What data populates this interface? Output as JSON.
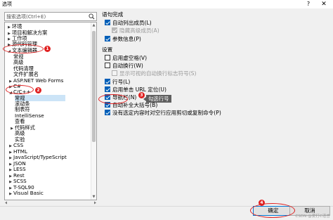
{
  "window": {
    "title": "选项",
    "help_label": "?",
    "close_label": "✕"
  },
  "search": {
    "placeholder": "搜索选项(Ctrl+E)"
  },
  "tree": {
    "items": [
      {
        "label": "环境",
        "arrow": "▶"
      },
      {
        "label": "项目和解决方案",
        "arrow": "▶"
      },
      {
        "label": "工作项",
        "arrow": "▶"
      },
      {
        "label": "源代码管理",
        "arrow": "▶"
      },
      {
        "label": "文本编辑器",
        "arrow": "◢"
      },
      {
        "label": "常规",
        "arrow": ""
      },
      {
        "label": "高级",
        "arrow": ""
      },
      {
        "label": "代码清理",
        "arrow": ""
      },
      {
        "label": "文件扩展名",
        "arrow": ""
      },
      {
        "label": "ASP.NET Web Forms",
        "arrow": "▶"
      },
      {
        "label": "C#",
        "arrow": "▶"
      },
      {
        "label": "C/C++",
        "arrow": "◢"
      },
      {
        "label": "常规",
        "arrow": ""
      },
      {
        "label": "滚动条",
        "arrow": ""
      },
      {
        "label": "制表符",
        "arrow": ""
      },
      {
        "label": "IntelliSense",
        "arrow": ""
      },
      {
        "label": "查看",
        "arrow": ""
      },
      {
        "label": "代码样式",
        "arrow": "▶"
      },
      {
        "label": "高级",
        "arrow": ""
      },
      {
        "label": "实验",
        "arrow": ""
      },
      {
        "label": "CSS",
        "arrow": "▶"
      },
      {
        "label": "HTML",
        "arrow": "▶"
      },
      {
        "label": "JavaScript/TypeScript",
        "arrow": "▶"
      },
      {
        "label": "JSON",
        "arrow": "▶"
      },
      {
        "label": "LESS",
        "arrow": "▶"
      },
      {
        "label": "Rest",
        "arrow": "▶"
      },
      {
        "label": "SCSS",
        "arrow": "▶"
      },
      {
        "label": "T-SQL90",
        "arrow": "▶"
      },
      {
        "label": "Visual Basic",
        "arrow": "▶"
      }
    ]
  },
  "completion": {
    "heading": "语句完成",
    "options": [
      {
        "label": "自动列出成员(L)",
        "checked": true,
        "disabled": false
      },
      {
        "label": "隐藏高级成员(A)",
        "checked": true,
        "disabled": true
      },
      {
        "label": "参数信息(P)",
        "checked": true,
        "disabled": false
      }
    ]
  },
  "settings": {
    "heading": "设置",
    "options": [
      {
        "label": "启用虚空格(V)",
        "checked": false,
        "disabled": false
      },
      {
        "label": "自动换行(W)",
        "checked": false,
        "disabled": false
      },
      {
        "label": "显示可视的自动换行标志符号(S)",
        "checked": false,
        "disabled": true
      },
      {
        "label": "行号(L)",
        "checked": true,
        "disabled": false
      },
      {
        "label": "启用单击 URL 定位(U)",
        "checked": true,
        "disabled": false
      },
      {
        "label": "导航栏(N)",
        "checked": true,
        "disabled": false
      },
      {
        "label": "自动补全大括号(B)",
        "checked": true,
        "disabled": false
      },
      {
        "label": "没有选定内容时对空行应用剪切或复制命令(P)",
        "checked": true,
        "disabled": false
      }
    ]
  },
  "annotations": {
    "b1": "1",
    "b2": "2",
    "b3": "3",
    "b4": "4",
    "tooltip": "勾选行号"
  },
  "buttons": {
    "ok": "确定",
    "cancel": "取消"
  },
  "watermark": "CSDN @爱打C语言"
}
